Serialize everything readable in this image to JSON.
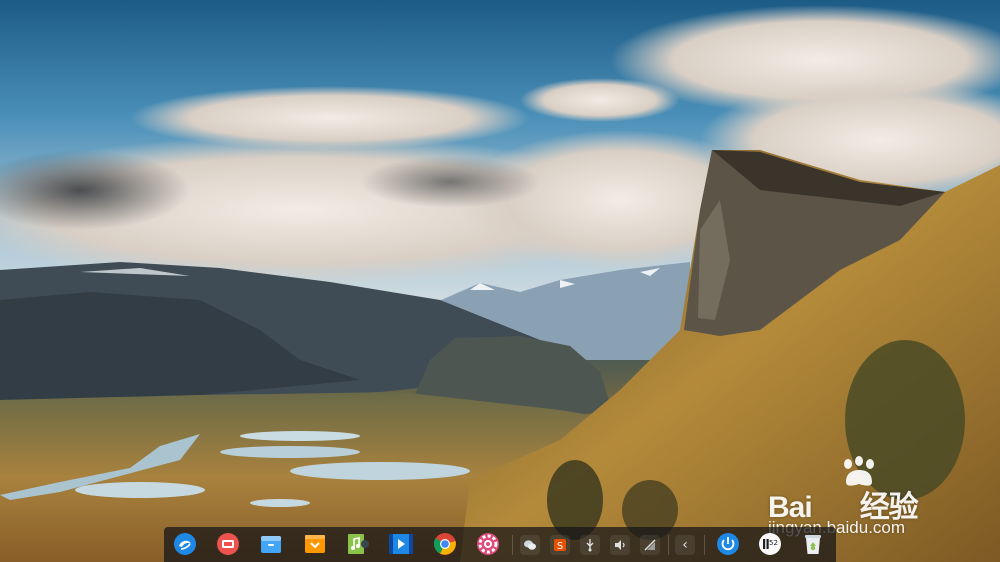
{
  "desktop": {
    "wallpaper": "mountain-valley-landscape"
  },
  "watermark": {
    "brand_left": "Bai",
    "brand_right": "经验",
    "url": "jingyan.baidu.com"
  },
  "dock": {
    "apps": [
      {
        "name": "launcher-icon",
        "color": "#1e88e5"
      },
      {
        "name": "multitasking-view-icon",
        "color": "#ef5350"
      },
      {
        "name": "file-manager-icon",
        "color": "#42a5f5"
      },
      {
        "name": "app-store-icon",
        "color": "#ff9800"
      },
      {
        "name": "music-player-icon",
        "color": "#8bc34a"
      },
      {
        "name": "video-player-icon",
        "color": "#1e88e5"
      },
      {
        "name": "chrome-icon",
        "color": "#db4437"
      },
      {
        "name": "settings-icon",
        "color": "#e04a7a"
      }
    ],
    "tray": [
      {
        "name": "wechat-tray-icon"
      },
      {
        "name": "sogou-input-tray-icon"
      },
      {
        "name": "usb-tray-icon"
      },
      {
        "name": "volume-tray-icon"
      },
      {
        "name": "network-tray-icon"
      }
    ],
    "collapse_label": "‹",
    "clock_time": "52",
    "power_color": "#1e88e5",
    "trash_color": "#8bc34a"
  }
}
